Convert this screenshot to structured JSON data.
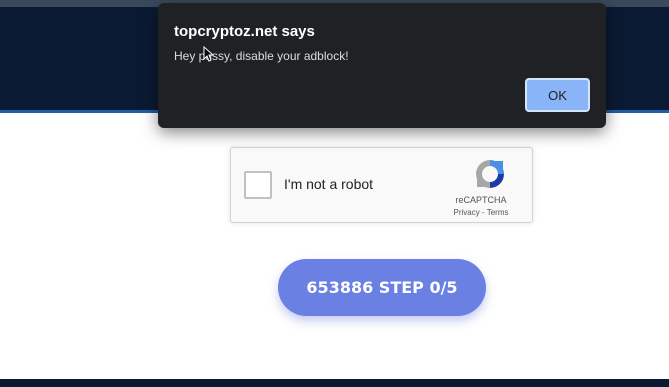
{
  "alert": {
    "title": "topcryptoz.net says",
    "message": "Hey pussy, disable your adblock!",
    "ok_label": "OK"
  },
  "recaptcha": {
    "label": "I'm not a robot",
    "brand": "reCAPTCHA",
    "privacy": "Privacy",
    "separator": " - ",
    "terms": "Terms"
  },
  "step_button": {
    "label": "653886 STEP 0/5"
  },
  "colors": {
    "header_bg": "#0b1a33",
    "button_bg": "#6a80e3",
    "alert_bg": "#202124",
    "alert_ok_bg": "#8ab4f8"
  }
}
